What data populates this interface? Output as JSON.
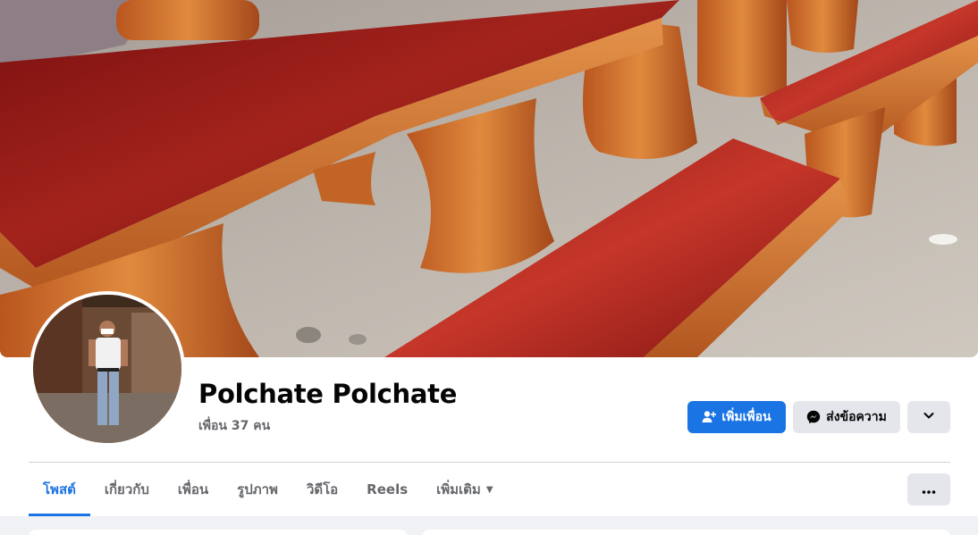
{
  "profile": {
    "name": "Polchate Polchate",
    "friends_text": "เพื่อน 37 คน"
  },
  "actions": {
    "add_friend_label": "เพิ่มเพื่อน",
    "add_friend_icon": "add-friend-icon",
    "message_label": "ส่งข้อความ",
    "message_icon": "messenger-icon",
    "more_icon": "chevron-down-icon"
  },
  "tabs": [
    {
      "label": "โพสต์",
      "active": true
    },
    {
      "label": "เกี่ยวกับ",
      "active": false
    },
    {
      "label": "เพื่อน",
      "active": false
    },
    {
      "label": "รูปภาพ",
      "active": false
    },
    {
      "label": "วิดีโอ",
      "active": false
    },
    {
      "label": "Reels",
      "active": false
    },
    {
      "label": "เพิ่มเติม",
      "active": false
    }
  ],
  "tabs_more_icon": "ellipsis-icon",
  "colors": {
    "accent": "#1b74e4",
    "secondary_button": "#e4e6eb",
    "text_primary": "#050505",
    "text_secondary": "#65676b",
    "feed_background": "#f0f2f5"
  }
}
